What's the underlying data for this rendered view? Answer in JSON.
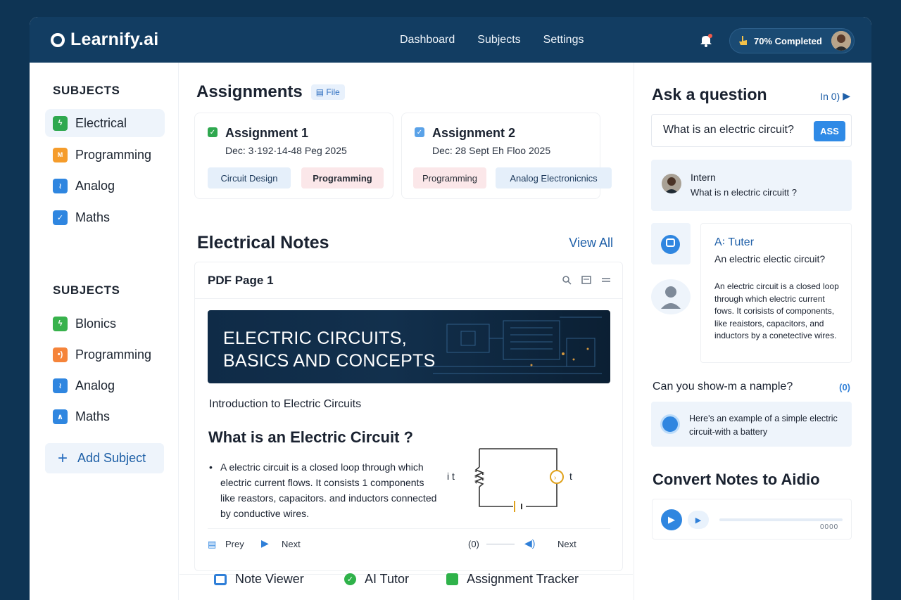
{
  "header": {
    "logo": "Learnify.ai",
    "nav": [
      "Dashboard",
      "Subjects",
      "Settings"
    ],
    "progress": "70% Completed"
  },
  "sidebar": {
    "section1_title": "SUBJECTS",
    "section1_items": [
      {
        "label": "Electrical",
        "icon": "bolt-icon",
        "color": "#2fa84f"
      },
      {
        "label": "Programming",
        "icon": "code-icon",
        "color": "#f59c2b"
      },
      {
        "label": "Analog",
        "icon": "wave-icon",
        "color": "#2f86e0"
      },
      {
        "label": "Maths",
        "icon": "check-icon",
        "color": "#2f86e0"
      }
    ],
    "section2_title": "SUBJECTS",
    "section2_items": [
      {
        "label": "Blonics",
        "icon": "bolt-icon",
        "color": "#38b24c"
      },
      {
        "label": "Programming",
        "icon": "code-icon",
        "color": "#f5843a"
      },
      {
        "label": "Analog",
        "icon": "wave-icon",
        "color": "#2f86e0"
      },
      {
        "label": "Maths",
        "icon": "chevron-up-icon",
        "color": "#2f86e0"
      }
    ],
    "add_label": "Add Subject"
  },
  "assignments": {
    "title": "Assignments",
    "file_chip": "File",
    "cards": [
      {
        "title": "Assignment 1",
        "date": "Dec: 3·192·14-48 Peg 2025",
        "tags": [
          "Circuit Design",
          "Programming"
        ]
      },
      {
        "title": "Assignment 2",
        "date": "Dec: 28 Sept Eh Floo 2025",
        "tags": [
          "Programming",
          "Analog Electronicnics"
        ]
      }
    ]
  },
  "notes": {
    "title": "Electrical Notes",
    "view_all": "View All",
    "pdf_title": "PDF Page 1",
    "banner_line1": "ELECTRIC CIRCUITS,",
    "banner_line2": "BASICS AND CONCEPTS",
    "intro": "Introduction to Electric Circuits",
    "question": "What is an Electric Circuit ?",
    "body": "A electric circuit is a closed loop through which electric current flows. It consists 1 components like reastors, capacitors. and inductors connected by conductive wires.",
    "circuit_left_label": "i t",
    "circuit_right_label": "t",
    "prev": "Prey",
    "next": "Next",
    "counter": "(0)",
    "next2": "Next"
  },
  "features": [
    "Note Viewer",
    "AI Tutor",
    "Assignment Tracker"
  ],
  "ask": {
    "title": "Ask a question",
    "count": "In 0)",
    "input": "What is an electric circuit?",
    "button": "ASS",
    "user_name": "Intern",
    "user_msg": "What is n electric circuitt ?",
    "tutor_name": "A꞉ Tuter",
    "tutor_q": "An electric electic circuit?",
    "tutor_answer": "An electric circuit is a closed loop through which electric current fows. It corisists of components, like reaistors, capacitors, and inductors by a conetective wires.",
    "followup": "Can you  show-m a nample?",
    "followup_icon": "(0)",
    "example_msg": "Here's an example of a simple electric circuit-with a battery"
  },
  "convert": {
    "title": "Convert Notes to Aidio",
    "dots": "0000"
  }
}
